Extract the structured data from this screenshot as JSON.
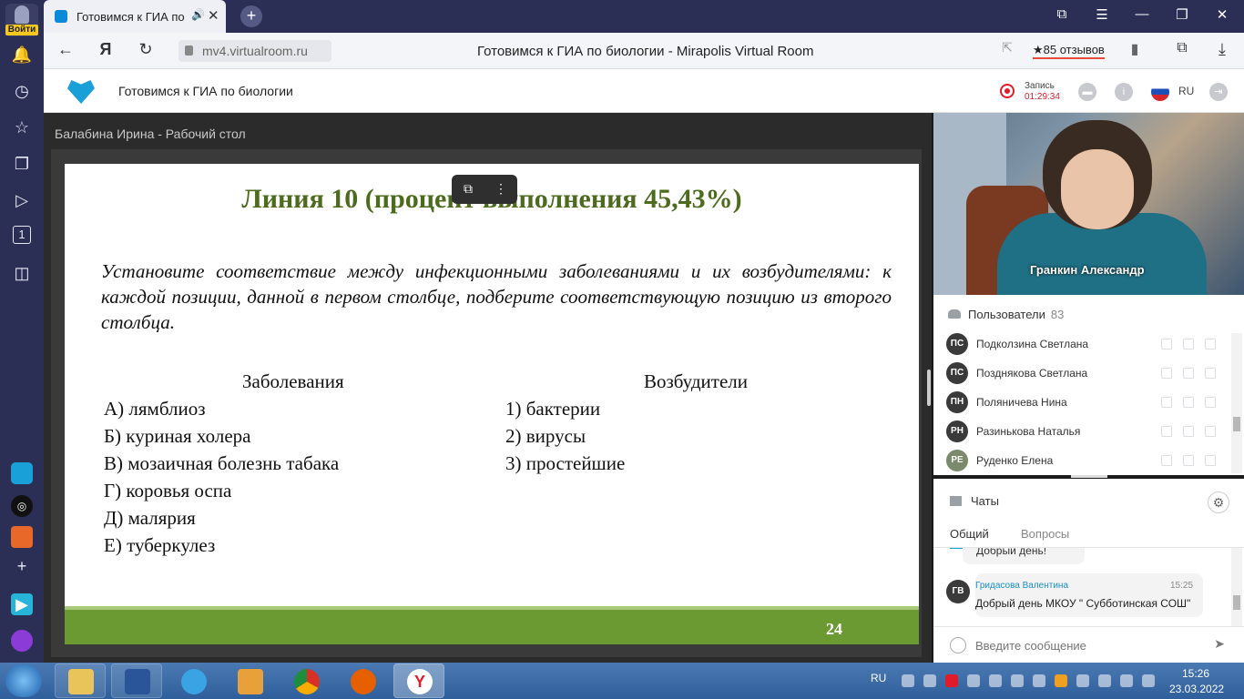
{
  "browser": {
    "login_label": "Войти",
    "tab_title": "Готовимся к ГИА по",
    "new_tab": "+",
    "url": "mv4.virtualroom.ru",
    "page_title": "Готовимся к ГИА по биологии - Mirapolis Virtual Room",
    "reviews": "★85 отзывов",
    "left_rail_icons": [
      "bell-icon",
      "clock-icon",
      "star-icon",
      "collections-icon",
      "play-icon",
      "one-icon",
      "camera-icon",
      "alice-icon",
      "dots-app-icon",
      "mail-icon",
      "plus-icon",
      "video-app-icon",
      "assistant-icon"
    ]
  },
  "header": {
    "title": "Готовимся к ГИА по биологии",
    "record_label": "Запись",
    "record_time": "01:29:34",
    "lang": "RU"
  },
  "share": {
    "owner": "Балабина Ирина - Рабочий стол"
  },
  "slide": {
    "heading": "Линия 10 (процент выполнения 45,43%)",
    "task": "Установите соответствие между инфекционными заболеваниями и их возбудителями: к каждой позиции, данной в первом столбце, подберите соответствующую позицию из второго столбца.",
    "col1_header": "Заболевания",
    "col2_header": "Возбудители",
    "diseases": [
      "А) лямблиоз",
      "Б) куриная холера",
      "В) мозаичная болезнь табака",
      "Г) коровья оспа",
      "Д) малярия",
      "Е) туберкулез"
    ],
    "pathogens": [
      "1) бактерии",
      "2) вирусы",
      "3) простейшие"
    ],
    "page_no": "24"
  },
  "video": {
    "name": "Гранкин Александр"
  },
  "users": {
    "title": "Пользователи",
    "count": "83",
    "list": [
      {
        "initials": "ПС",
        "name": "Подколзина Светлана",
        "color": "#3a3a3a"
      },
      {
        "initials": "ПС",
        "name": "Позднякова Светлана",
        "color": "#3a3a3a"
      },
      {
        "initials": "ПН",
        "name": "Поляничева Нина",
        "color": "#3a3a3a"
      },
      {
        "initials": "РН",
        "name": "Разинькова Наталья",
        "color": "#3a3a3a"
      },
      {
        "initials": "РЕ",
        "name": "Руденко Елена",
        "color": "#7a8a6a"
      }
    ]
  },
  "chats": {
    "title": "Чаты",
    "tab_general": "Общий",
    "tab_questions": "Вопросы",
    "prev_message": "Добрый день!",
    "message": {
      "initials": "ГВ",
      "author": "Гридасова Валентина",
      "time": "15:25",
      "text": "Добрый день МКОУ \" Субботинская СОШ\""
    },
    "input_placeholder": "Введите сообщение"
  },
  "taskbar": {
    "lang": "RU",
    "time": "15:26",
    "date": "23.03.2022"
  },
  "colors": {
    "browser_dark": "#2b2f55",
    "accent": "#1aa0d8",
    "slide_green": "#4d6b1c",
    "record_red": "#e21b2b"
  }
}
